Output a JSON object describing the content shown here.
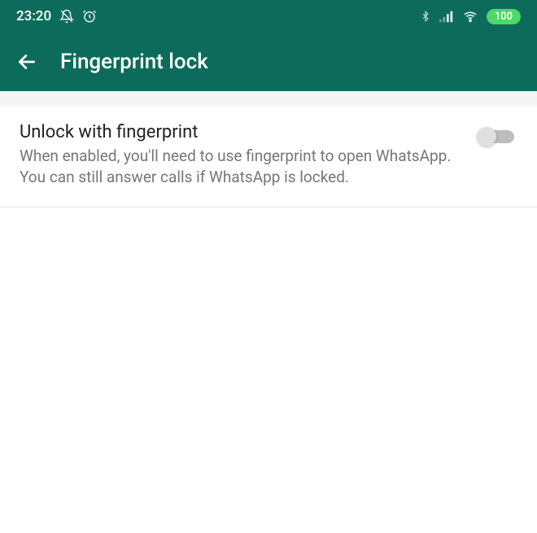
{
  "status": {
    "time": "23:20",
    "battery": "100"
  },
  "header": {
    "title": "Fingerprint lock"
  },
  "setting": {
    "title": "Unlock with fingerprint",
    "description": "When enabled, you'll need to use fingerprint to open WhatsApp. You can still answer calls if WhatsApp is locked.",
    "enabled": false
  }
}
